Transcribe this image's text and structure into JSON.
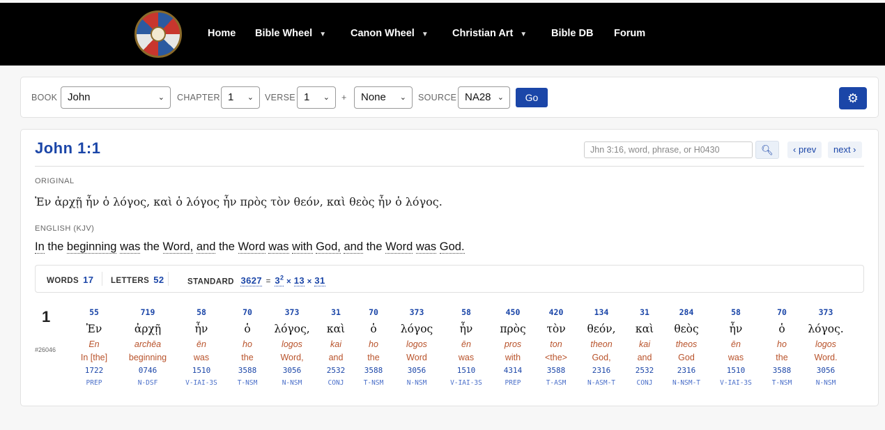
{
  "nav": {
    "items": [
      {
        "label": "Home",
        "caret": false
      },
      {
        "label": "Bible Wheel",
        "caret": true
      },
      {
        "label": "Canon Wheel",
        "caret": true
      },
      {
        "label": "Christian Art",
        "caret": true
      },
      {
        "label": "Bible DB",
        "caret": false
      },
      {
        "label": "Forum",
        "caret": false
      }
    ]
  },
  "toolbar": {
    "book_label": "BOOK",
    "book_value": "John",
    "chapter_label": "CHAPTER",
    "chapter_value": "1",
    "verse_label": "VERSE",
    "verse_value": "1",
    "plus": "+",
    "extra_value": "None",
    "source_label": "SOURCE",
    "source_value": "NA28",
    "go_label": "Go",
    "settings_icon": "gear-icon"
  },
  "verse": {
    "title": "John 1:1",
    "search_placeholder": "Jhn 3:16, word, phrase, or H0430",
    "prev_label": "‹ prev",
    "next_label": "next ›",
    "original_label": "ORIGINAL",
    "original_text": "Ἐν ἀρχῇ ἦν ὁ λόγος, καὶ ὁ λόγος ἦν πρὸς τὸν θεόν, καὶ θεὸς ἦν ὁ λόγος.",
    "english_label": "ENGLISH (KJV)",
    "english_words": [
      "In",
      "the",
      "beginning",
      "was",
      "the",
      "Word,",
      "and",
      "the",
      "Word",
      "was",
      "with",
      "God,",
      "and",
      "the",
      "Word",
      "was",
      "God."
    ],
    "stats": {
      "words_label": "WORDS",
      "words_value": "17",
      "letters_label": "LETTERS",
      "letters_value": "52",
      "standard_label": "STANDARD",
      "standard_value": "3627",
      "eq": "=",
      "f1": "3",
      "f1_exp": "2",
      "times": "×",
      "f2": "13",
      "f3": "31"
    },
    "verse_number": "1",
    "verse_id": "#26046",
    "words": [
      {
        "val": "55",
        "greek": "Ἐν",
        "translit": "En",
        "english": "In [the]",
        "strongs": "1722",
        "morph": "PREP"
      },
      {
        "val": "719",
        "greek": "ἀρχῇ",
        "translit": "archēa",
        "english": "beginning",
        "strongs": "0746",
        "morph": "N-DSF"
      },
      {
        "val": "58",
        "greek": "ἦν",
        "translit": "ēn",
        "english": "was",
        "strongs": "1510",
        "morph": "V-IAI-3S"
      },
      {
        "val": "70",
        "greek": "ὁ",
        "translit": "ho",
        "english": "the",
        "strongs": "3588",
        "morph": "T-NSM"
      },
      {
        "val": "373",
        "greek": "λόγος,",
        "translit": "logos",
        "english": "Word,",
        "strongs": "3056",
        "morph": "N-NSM"
      },
      {
        "val": "31",
        "greek": "καὶ",
        "translit": "kai",
        "english": "and",
        "strongs": "2532",
        "morph": "CONJ"
      },
      {
        "val": "70",
        "greek": "ὁ",
        "translit": "ho",
        "english": "the",
        "strongs": "3588",
        "morph": "T-NSM"
      },
      {
        "val": "373",
        "greek": "λόγος",
        "translit": "logos",
        "english": "Word",
        "strongs": "3056",
        "morph": "N-NSM"
      },
      {
        "val": "58",
        "greek": "ἦν",
        "translit": "ēn",
        "english": "was",
        "strongs": "1510",
        "morph": "V-IAI-3S"
      },
      {
        "val": "450",
        "greek": "πρὸς",
        "translit": "pros",
        "english": "with",
        "strongs": "4314",
        "morph": "PREP"
      },
      {
        "val": "420",
        "greek": "τὸν",
        "translit": "ton",
        "english": "<the>",
        "strongs": "3588",
        "morph": "T-ASM"
      },
      {
        "val": "134",
        "greek": "θεόν,",
        "translit": "theon",
        "english": "God,",
        "strongs": "2316",
        "morph": "N-ASM-T"
      },
      {
        "val": "31",
        "greek": "καὶ",
        "translit": "kai",
        "english": "and",
        "strongs": "2532",
        "morph": "CONJ"
      },
      {
        "val": "284",
        "greek": "θεὸς",
        "translit": "theos",
        "english": "God",
        "strongs": "2316",
        "morph": "N-NSM-T"
      },
      {
        "val": "58",
        "greek": "ἦν",
        "translit": "ēn",
        "english": "was",
        "strongs": "1510",
        "morph": "V-IAI-3S"
      },
      {
        "val": "70",
        "greek": "ὁ",
        "translit": "ho",
        "english": "the",
        "strongs": "3588",
        "morph": "T-NSM"
      },
      {
        "val": "373",
        "greek": "λόγος.",
        "translit": "logos",
        "english": "Word.",
        "strongs": "3056",
        "morph": "N-NSM"
      }
    ]
  }
}
